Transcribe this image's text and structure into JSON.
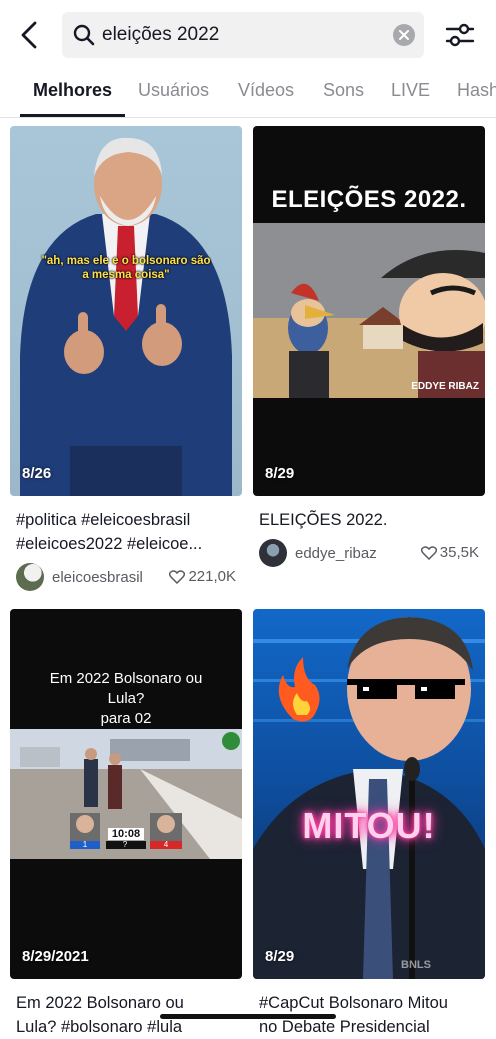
{
  "search": {
    "query": "eleições 2022"
  },
  "tabs": [
    {
      "label": "Melhores"
    },
    {
      "label": "Usuários"
    },
    {
      "label": "Vídeos"
    },
    {
      "label": "Sons"
    },
    {
      "label": "LIVE"
    },
    {
      "label": "Hashtags"
    }
  ],
  "results": [
    {
      "overlay_text": "\"ah, mas ele e o bolsonaro são a mesma coisa\"",
      "count": "8/26",
      "caption_line1": "#politica #eleicoesbrasil",
      "caption_line2": "#eleicoes2022 #eleicoe...",
      "username": "eleicoesbrasil",
      "likes": "221,0K"
    },
    {
      "overlay_title": "ELEIÇÕES 2022.",
      "watermark": "EDDYE RIBAZ",
      "count": "8/29",
      "caption_line1": "ELEIÇÕES 2022.",
      "username": "eddye_ribaz",
      "likes": "35,5K"
    },
    {
      "overlay_line1": "Em 2022 Bolsonaro ou",
      "overlay_line2": "Lula?",
      "overlay_line3": "para 02",
      "debate_time": "10:08",
      "vote_left": "1",
      "vote_mid": "?",
      "vote_right": "4",
      "count": "8/29/2021",
      "caption_line1": "Em 2022 Bolsonaro ou",
      "caption_line2": "Lula? #bolsonaro #lula"
    },
    {
      "overlay_text": "MITOU!",
      "watermark": "BNLS",
      "count": "8/29",
      "caption_line1": "#CapCut Bolsonaro Mitou",
      "caption_line2": "no Debate Presidencial"
    }
  ],
  "colors": {
    "tab_active": "#161823",
    "tab_inactive": "#8a8b91",
    "neon_pink": "#ff3ea5"
  }
}
